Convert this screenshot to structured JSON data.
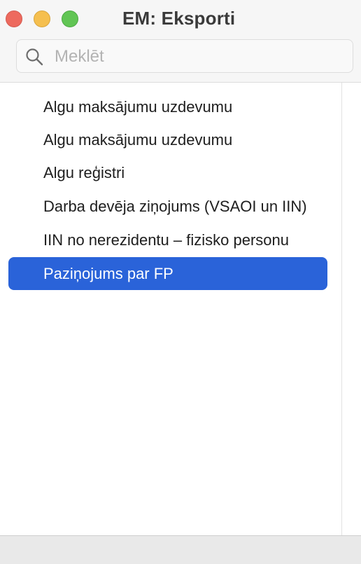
{
  "window": {
    "title": "EM: Eksporti"
  },
  "search": {
    "placeholder": "Meklēt",
    "value": "",
    "icon": "search-icon"
  },
  "list": {
    "items": [
      {
        "label": "Algu maksājumu uzdevumu",
        "selected": false
      },
      {
        "label": "Algu maksājumu uzdevumu",
        "selected": false
      },
      {
        "label": "Algu reģistri",
        "selected": false
      },
      {
        "label": "Darba devēja ziņojums (VSAOI un IIN)",
        "selected": false
      },
      {
        "label": "IIN no nerezidentu – fizisko personu",
        "selected": false
      },
      {
        "label": "Paziņojums par FP",
        "selected": true
      }
    ]
  },
  "colors": {
    "selection": "#2a63d9",
    "close": "#ed6a5e",
    "minimize": "#f5bf4f",
    "maximize": "#61c554"
  }
}
